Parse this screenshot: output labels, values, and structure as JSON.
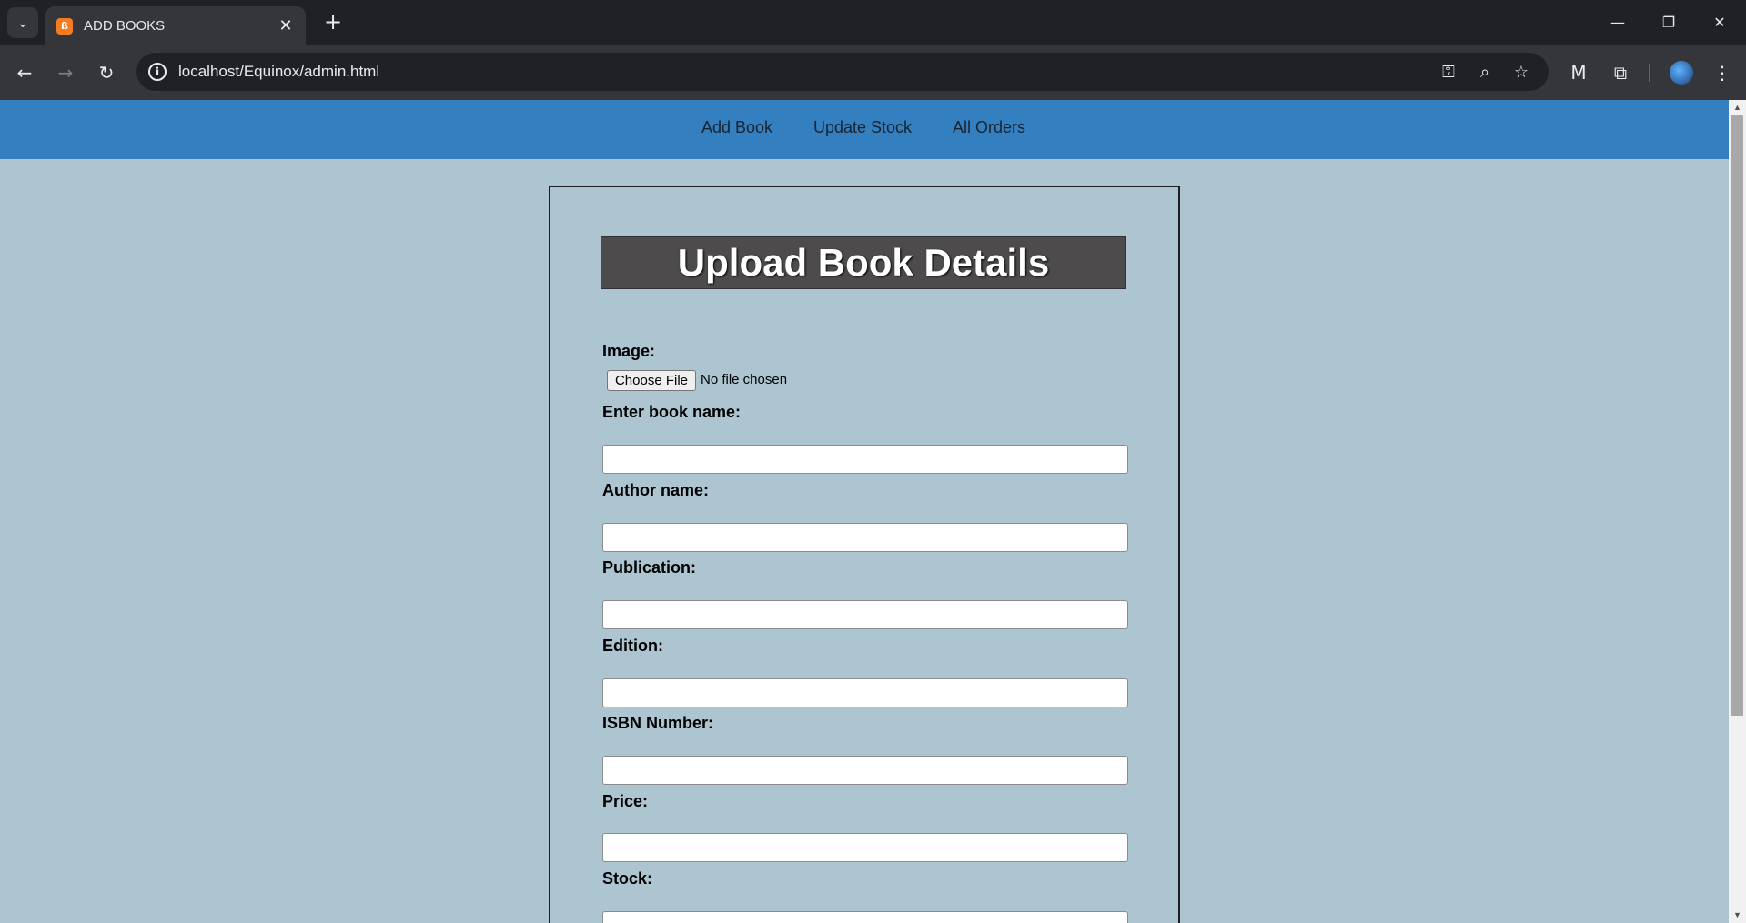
{
  "browser": {
    "tab_title": "ADD BOOKS",
    "favicon_glyph": "ß",
    "url": "localhost/Equinox/admin.html",
    "icons": {
      "tab_search": "chevron-down-icon",
      "new_tab": "plus-icon",
      "back": "back-arrow-icon",
      "forward": "forward-arrow-icon",
      "reload": "reload-icon",
      "site_info": "info-icon",
      "passwords": "key-icon",
      "zoom": "zoom-icon",
      "bookmark": "star-icon",
      "extension_malwarebytes": "malwarebytes-icon",
      "extensions": "puzzle-icon",
      "menu": "more-vertical-icon"
    }
  },
  "nav": {
    "links": [
      "Add Book",
      "Update Stock",
      "All Orders"
    ]
  },
  "form": {
    "title": "Upload Book Details",
    "image_label": "Image:",
    "choose_file_label": "Choose File",
    "file_status": "No file chosen",
    "fields": [
      {
        "label": "Enter book name:",
        "value": ""
      },
      {
        "label": "Author name:",
        "value": ""
      },
      {
        "label": "Publication:",
        "value": ""
      },
      {
        "label": "Edition:",
        "value": ""
      },
      {
        "label": "ISBN Number:",
        "value": ""
      },
      {
        "label": "Price:",
        "value": ""
      },
      {
        "label": "Stock:",
        "value": ""
      }
    ]
  },
  "colors": {
    "nav_bar": "#337fbf",
    "page_bg": "#acc5d1",
    "header_bg": "#4d4b4c"
  }
}
